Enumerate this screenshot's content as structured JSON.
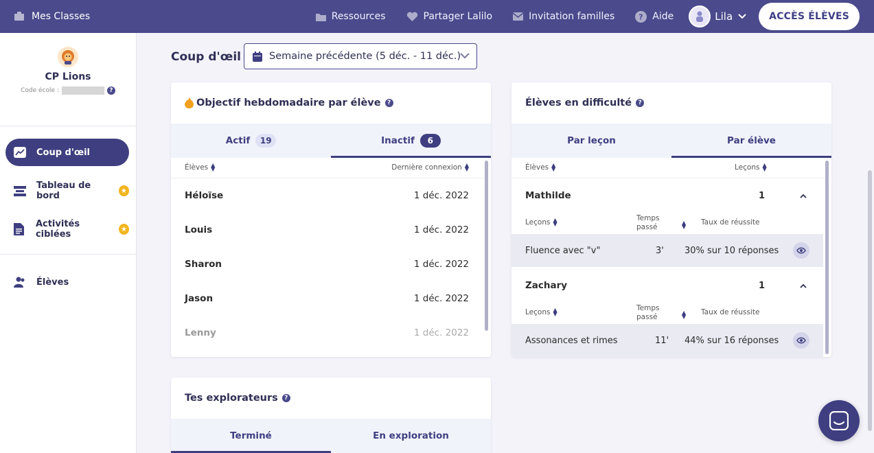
{
  "topbar": {
    "classes_label": "Mes Classes",
    "nav": [
      {
        "label": "Ressources",
        "icon": "folder-icon"
      },
      {
        "label": "Partager Lalilo",
        "icon": "heart-icon"
      },
      {
        "label": "Invitation familles",
        "icon": "mail-icon"
      },
      {
        "label": "Aide",
        "icon": "help-circle-icon"
      }
    ],
    "user_name": "Lila",
    "acces_button": "ACCÈS ÉLÈVES"
  },
  "sidebar": {
    "class_name": "CP Lions",
    "code_label": "Code école :",
    "items": [
      {
        "label": "Coup d'œil",
        "icon": "chart-icon",
        "active": true
      },
      {
        "label": "Tableau de bord",
        "icon": "dashboard-icon",
        "star": true
      },
      {
        "label": "Activités ciblées",
        "icon": "document-icon",
        "star": true
      },
      {
        "label": "Élèves",
        "icon": "students-icon"
      }
    ]
  },
  "main": {
    "title": "Coup d'œil",
    "week_select": "Semaine précédente (5 déc. - 11 déc.)"
  },
  "objective_card": {
    "title": "Objectif hebdomadaire par élève",
    "tabs": [
      {
        "label": "Actif",
        "count": "19"
      },
      {
        "label": "Inactif",
        "count": "6"
      }
    ],
    "col_students": "Élèves",
    "col_last": "Dernière connexion",
    "rows": [
      {
        "name": "Héloïse",
        "date": "1 déc. 2022"
      },
      {
        "name": "Louis",
        "date": "1 déc. 2022"
      },
      {
        "name": "Sharon",
        "date": "1 déc. 2022"
      },
      {
        "name": "Jason",
        "date": "1 déc. 2022"
      },
      {
        "name": "Lenny",
        "date": "1 déc. 2022"
      }
    ]
  },
  "difficulty_card": {
    "title": "Élèves en difficulté",
    "tabs": [
      {
        "label": "Par leçon"
      },
      {
        "label": "Par élève"
      }
    ],
    "col_students": "Élèves",
    "col_lessons": "Leçons",
    "sub_lessons": "Leçons",
    "sub_time_1": "Temps",
    "sub_time_2": "passé",
    "sub_rate": "Taux de réussite",
    "students": [
      {
        "name": "Mathilde",
        "count": "1",
        "lesson": "Fluence avec \"v\"",
        "time": "3'",
        "rate": "30% sur 10 réponses"
      },
      {
        "name": "Zachary",
        "count": "1",
        "lesson": "Assonances et rimes",
        "time": "11'",
        "rate": "44% sur 16 réponses"
      }
    ]
  },
  "explorers_card": {
    "title": "Tes explorateurs",
    "tabs": [
      {
        "label": "Terminé"
      },
      {
        "label": "En exploration"
      }
    ]
  }
}
